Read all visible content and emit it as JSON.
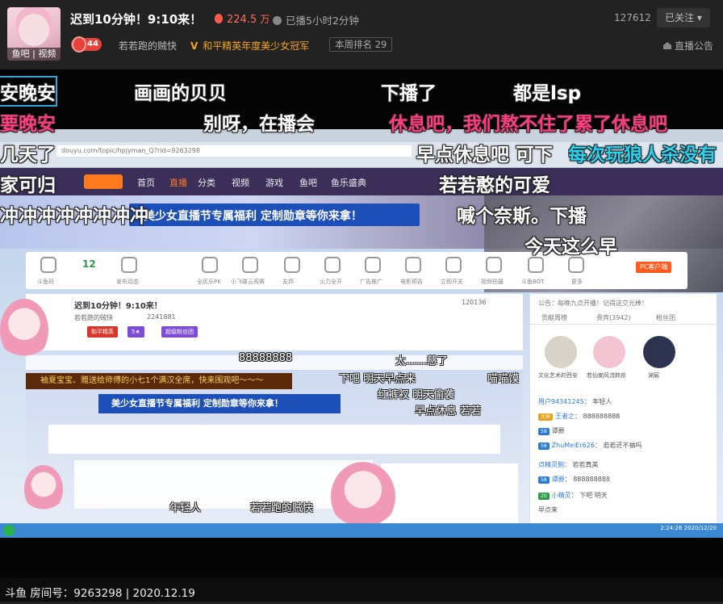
{
  "header": {
    "avatar_tag": "鱼吧 | 视频",
    "title": "迟到10分钟！9:10来！",
    "hot_value": "224.5",
    "hot_unit": "万",
    "uptime": "已播5小时2分钟",
    "follow_count": "127612",
    "follow_button": "已关注",
    "level": "44",
    "anchor_name": "若若跑的贼快",
    "champion": "和平精英年度美少女冠军",
    "rank": "本周排名 29",
    "announce": "直播公告"
  },
  "stream": {
    "url": "douyu.com/topic/hpjyman_Q?rid=9263298",
    "site_nav": [
      "首页",
      "直播",
      "分类",
      "视频",
      "游戏",
      "鱼吧",
      "鱼乐盛典"
    ],
    "banner_text": "美少女直播节专属福利  定制勋章等你来拿！",
    "iconbar_items": [
      "斗鱼码",
      "12",
      "发布动态",
      "全民乐PK",
      "小飞碟云观赛",
      "友邦",
      "火力全开",
      "广告推广",
      "电影预告",
      "立即开关",
      "视频拍摄",
      "斗鱼BOT",
      "更多",
      "PC客户端"
    ],
    "inner_title": "迟到10分钟！9:10来！",
    "inner_anchor": "若若跑的贼快",
    "inner_stats": "2241881",
    "inner_follow": "120136",
    "pill_red": "和平精英",
    "pill_purple": "超级粉丝团",
    "pill_orange": "5★",
    "notice_text": "袖夏宝宝、赠送给师傅的小七1个满汉全席，快来围观吧～～～",
    "ribbon2_text": "美少女直播节专属福利  定制勋章等你来拿！",
    "side_tabs": [
      "贡献周榜",
      "贵宾(3942)",
      "粉丝团"
    ],
    "side_notice": "公告：每晚九点开播！记得这交光棒！",
    "fan_names": [
      "文化艺术的西安",
      "若仙痴风流韩依",
      "渊宸"
    ],
    "chat": [
      {
        "user": "用户94341245",
        "badge": "王者",
        "msg": "年轻人"
      },
      {
        "user": "王者之",
        "badge": "大神",
        "msg": "888888888"
      },
      {
        "user": "",
        "badge": "58",
        "msg": "谭爵"
      },
      {
        "user": "ZhuMeiEr626",
        "badge": "58",
        "msg": "若若还不抽吗"
      },
      {
        "user": "点精灵侧",
        "badge": "",
        "msg": "若若真美"
      },
      {
        "user": "谭爵",
        "badge": "58",
        "msg": "888888888"
      },
      {
        "user": "小精灵",
        "badge": "20",
        "msg": "下吧 明天"
      },
      {
        "user": "早点来",
        "badge": "",
        "msg": ""
      }
    ],
    "taskbar_time": "2:24:26",
    "taskbar_date": "2020/12/20"
  },
  "danmaku": [
    {
      "id": "dm1",
      "text": "安晚安",
      "color": "white",
      "boxed": true
    },
    {
      "id": "dm2",
      "text": "画画的贝贝",
      "color": "white"
    },
    {
      "id": "dm3",
      "text": "下播了",
      "color": "white"
    },
    {
      "id": "dm4",
      "text": "都是lsp",
      "color": "white"
    },
    {
      "id": "dm5",
      "text": "要晚安",
      "color": "pink"
    },
    {
      "id": "dm6",
      "text": "别呀，在播会",
      "color": "white"
    },
    {
      "id": "dm7",
      "text": "休息吧，我们熬不住了累了休息吧",
      "color": "pink"
    },
    {
      "id": "dm8",
      "text": "几天了",
      "color": "white"
    },
    {
      "id": "dm9",
      "text": "早点休息吧 可下",
      "color": "white"
    },
    {
      "id": "dm10",
      "text": "每次玩狼人杀没有",
      "color": "cyan"
    },
    {
      "id": "dm11",
      "text": "家可归",
      "color": "white"
    },
    {
      "id": "dm12",
      "text": "若若憨的可爱",
      "color": "white"
    },
    {
      "id": "dm13",
      "text": "冲冲冲冲冲冲冲冲",
      "color": "white"
    },
    {
      "id": "dm14",
      "text": "喊个奈斯。下播",
      "color": "white"
    },
    {
      "id": "dm15",
      "text": "今天这么早",
      "color": "white"
    }
  ],
  "danmaku_small": [
    {
      "id": "dms1",
      "text": "88888888"
    },
    {
      "id": "dms2",
      "text": "太……慈了"
    },
    {
      "id": "dms3",
      "text": "下吧 明天早点来"
    },
    {
      "id": "dms4",
      "text": "红裤衩 明天偷袭"
    },
    {
      "id": "dms5",
      "text": "早点休息 若若"
    },
    {
      "id": "dms6",
      "text": "喵喵馍"
    },
    {
      "id": "dms7",
      "text": "年轻人"
    },
    {
      "id": "dms8",
      "text": "若若跑的贼快"
    }
  ],
  "footer": {
    "text": "斗鱼 房间号：9263298 | 2020.12.19"
  },
  "colors": {
    "danmaku_pink": "#ff3d7f",
    "danmaku_cyan": "#28d3f2",
    "hot": "#ff6b5e",
    "champion": "#f5a623",
    "level_badge": "#e8403a"
  }
}
